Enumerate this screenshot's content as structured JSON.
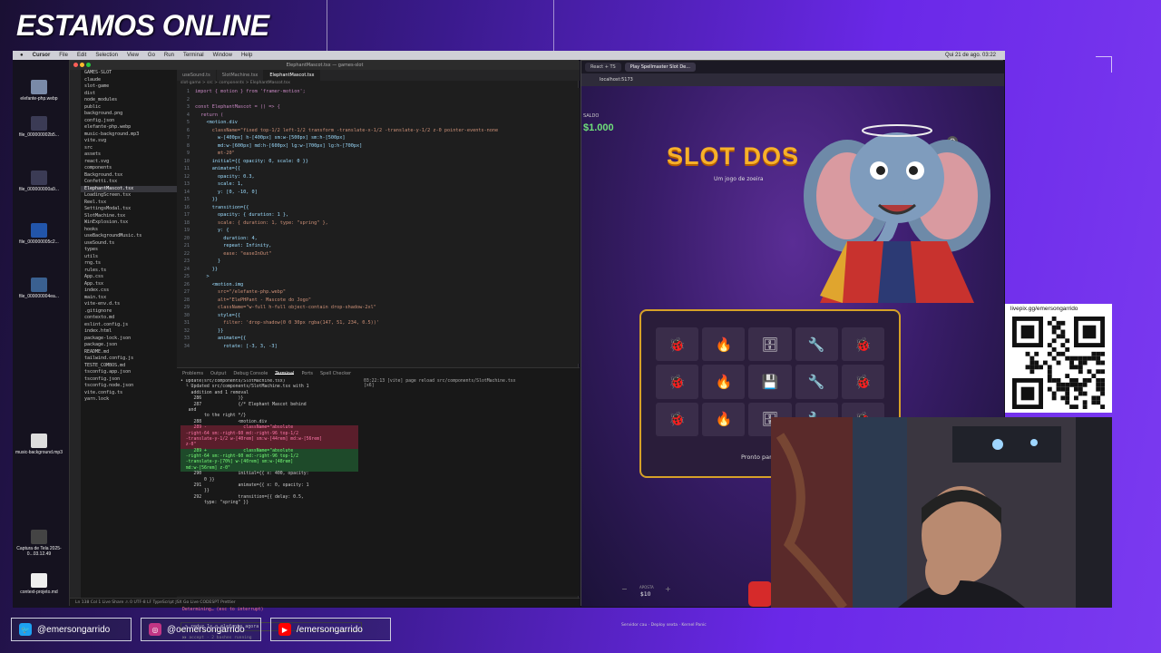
{
  "overlay": {
    "title": "ESTAMOS ONLINE"
  },
  "menubar": {
    "app": "Cursor",
    "items": [
      "File",
      "Edit",
      "Selection",
      "View",
      "Go",
      "Run",
      "Terminal",
      "Window",
      "Help"
    ],
    "clock": "Qui 21 de ago. 03:22"
  },
  "desktop_icons": [
    {
      "label": "elefante-php.webp"
    },
    {
      "label": "file_000000002b5..."
    },
    {
      "label": "file_000000000a9..."
    },
    {
      "label": "file_000000005c2..."
    },
    {
      "label": "file_000000004ea..."
    },
    {
      "label": "music-background.mp3"
    },
    {
      "label": "Captura de Tela 2025-0...03.12.49"
    },
    {
      "label": "context-projeto.md"
    }
  ],
  "vscode": {
    "title": "ElephantMascot.tsx — games-slot",
    "tabs": [
      "useSound.ts",
      "SlotMachine.tsx",
      "ElephantMascot.tsx"
    ],
    "active_tab": "ElephantMascot.tsx",
    "breadcrumb": "slot-game > src > components > ElephantMascot.tsx",
    "explorer": [
      "GAMES-SLOT",
      "claude",
      "slot-game",
      "dist",
      "node_modules",
      "public",
      "background.png",
      "config.json",
      "elefante-php.webp",
      "music-background.mp3",
      "vite.svg",
      "src",
      "assets",
      "react.svg",
      "components",
      "Background.tsx",
      "Confetti.tsx",
      "ElephantMascot.tsx",
      "LoadingScreen.tsx",
      "Reel.tsx",
      "SettingsModal.tsx",
      "SlotMachine.tsx",
      "WinExplosion.tsx",
      "hooks",
      "useBackgroundMusic.ts",
      "useSound.ts",
      "types",
      "utils",
      "rng.ts",
      "rules.ts",
      "App.css",
      "App.tsx",
      "index.css",
      "main.tsx",
      "vite-env.d.ts",
      ".gitignore",
      "contexto.md",
      "eslint.config.js",
      "index.html",
      "package-lock.json",
      "package.json",
      "README.md",
      "tailwind.config.js",
      "TESTE_COMBOS.md",
      "tsconfig.app.json",
      "tsconfig.json",
      "tsconfig.node.json",
      "vite.config.ts",
      "yarn.lock"
    ],
    "panel_tabs": [
      "Problems",
      "Output",
      "Debug Console",
      "Terminal",
      "Ports",
      "Spell Checker"
    ],
    "terminal_right": [
      "03:22:13 [vite] page reload src/components/SlotMachine.tsx",
      "[x6]"
    ],
    "terminal_prompt": "> reduz 1x o elefante agora",
    "terminal_status": "Determining… (esc to interrupt)",
    "terminal_accept": "⏵⏵ accept · 2 bashes running",
    "statusbar": "Ln 138  Col 1  Live Share  ⚠ 0  UTF-8  LF  TypeScript JSX  Go Live  CODESPT  Prettier"
  },
  "browser": {
    "tabs": [
      "React + TS",
      "Play Spellmaster Slot De..."
    ],
    "url": "localhost:5173",
    "saldo_label": "SALDO",
    "saldo_value": "$1.000",
    "title": "SLOT DOS",
    "subtitle": "Um jogo de zoeira",
    "ready_text": "Pronto para",
    "bet_label": "APOSTA",
    "bet_value": "$10",
    "bet_minus": "−",
    "bet_plus": "+",
    "status_line": "Servidor cau · Deploy sexta · Kernel Panic"
  },
  "reels": [
    [
      "🐞",
      "🔥",
      "🗄",
      "🔧",
      "🐞"
    ],
    [
      "🐞",
      "🔥",
      "💾",
      "🔧",
      "🐞"
    ],
    [
      "🐞",
      "🔥",
      "🗄",
      "🔧",
      "🐞"
    ]
  ],
  "qr": {
    "url": "livepix.gg/emersongarrido"
  },
  "social": [
    {
      "icon": "twitter-icon",
      "handle": "@emersongarrido",
      "color": "#1da1f2"
    },
    {
      "icon": "instagram-icon",
      "handle": "@oemersongarrido",
      "color": "#c13584"
    },
    {
      "icon": "youtube-icon",
      "handle": "/emersongarrido",
      "color": "#ff0000"
    }
  ],
  "code_lines": [
    {
      "n": "1",
      "t": "import { motion } from 'framer-motion';"
    },
    {
      "n": "2",
      "t": ""
    },
    {
      "n": "3",
      "t": "const ElephantMascot = () => {"
    },
    {
      "n": "4",
      "t": "  return ("
    },
    {
      "n": "5",
      "t": "    <motion.div"
    },
    {
      "n": "6",
      "t": "      className=\"fixed top-1/2 left-1/2 transform -translate-x-1/2 -translate-y-1/2 z-0 pointer-events-none"
    },
    {
      "n": "7",
      "t": "        w-[400px] h-[400px] sm:w-[500px] sm:h-[500px]"
    },
    {
      "n": "8",
      "t": "        md:w-[600px] md:h-[600px] lg:w-[700px] lg:h-[700px]"
    },
    {
      "n": "9",
      "t": "        mt-20\""
    },
    {
      "n": "10",
      "t": "      initial={{ opacity: 0, scale: 0 }}"
    },
    {
      "n": "11",
      "t": "      animate={{"
    },
    {
      "n": "12",
      "t": "        opacity: 0.3,"
    },
    {
      "n": "13",
      "t": "        scale: 1,"
    },
    {
      "n": "14",
      "t": "        y: [0, -10, 0]"
    },
    {
      "n": "15",
      "t": "      }}"
    },
    {
      "n": "16",
      "t": "      transition={{"
    },
    {
      "n": "17",
      "t": "        opacity: { duration: 1 },"
    },
    {
      "n": "18",
      "t": "        scale: { duration: 1, type: \"spring\" },"
    },
    {
      "n": "19",
      "t": "        y: {"
    },
    {
      "n": "20",
      "t": "          duration: 4,"
    },
    {
      "n": "21",
      "t": "          repeat: Infinity,"
    },
    {
      "n": "22",
      "t": "          ease: \"easeInOut\""
    },
    {
      "n": "23",
      "t": "        }"
    },
    {
      "n": "24",
      "t": "      }}"
    },
    {
      "n": "25",
      "t": "    >"
    },
    {
      "n": "26",
      "t": "      <motion.img"
    },
    {
      "n": "27",
      "t": "        src=\"/elefante-php.webp\""
    },
    {
      "n": "28",
      "t": "        alt=\"ElePHPant - Mascote do Jogo\""
    },
    {
      "n": "29",
      "t": "        className=\"w-full h-full object-contain drop-shadow-2xl\""
    },
    {
      "n": "30",
      "t": "        style={{"
    },
    {
      "n": "31",
      "t": "          filter: 'drop-shadow(0 0 30px rgba(147, 51, 234, 0.5))'"
    },
    {
      "n": "32",
      "t": "        }}"
    },
    {
      "n": "33",
      "t": "        animate={{"
    },
    {
      "n": "34",
      "t": "          rotate: [-3, 3, -3]"
    }
  ],
  "terminal_lines": [
    {
      "t": "• Update(src/components/SlotMachine.tsx)",
      "c": ""
    },
    {
      "t": "  └ Updated src/components/SlotMachine.tsx with 1",
      "c": ""
    },
    {
      "t": "    addition and 1 removal",
      "c": ""
    },
    {
      "t": "     286              )}",
      "c": ""
    },
    {
      "t": "     287              {/* Elephant Mascot behind",
      "c": ""
    },
    {
      "t": "   and",
      "c": ""
    },
    {
      "t": "         to the right */}",
      "c": ""
    },
    {
      "t": "     288              <motion.div",
      "c": ""
    },
    {
      "t": "     289 -              className=\"absolute",
      "c": "rm"
    },
    {
      "t": "  -right-64 sm:-right-60 md:-right-96 top-1/2",
      "c": "rm"
    },
    {
      "t": "  -translate-y-1/2 w-[40rem] sm:w-[44rem] md:w-[56rem]",
      "c": "rm"
    },
    {
      "t": "  z-0\"",
      "c": "rm"
    },
    {
      "t": "     289 +              className=\"absolute",
      "c": "ad"
    },
    {
      "t": "  -right-64 sm:-right-60 md:-right-96 top-1/2",
      "c": "ad"
    },
    {
      "t": "  -translate-y-[70%] w-[40rem] sm:w-[48rem]",
      "c": "ad"
    },
    {
      "t": "  md:w-[56rem] z-0\"",
      "c": "ad"
    },
    {
      "t": "     290              initial={{ x: 400, opacity:",
      "c": ""
    },
    {
      "t": "         0 }}",
      "c": ""
    },
    {
      "t": "     291              animate={{ x: 0, opacity: 1",
      "c": ""
    },
    {
      "t": "         }}",
      "c": ""
    },
    {
      "t": "     292              transition={{ delay: 0.5,",
      "c": ""
    },
    {
      "t": "         type: \"spring\" }}",
      "c": ""
    }
  ]
}
